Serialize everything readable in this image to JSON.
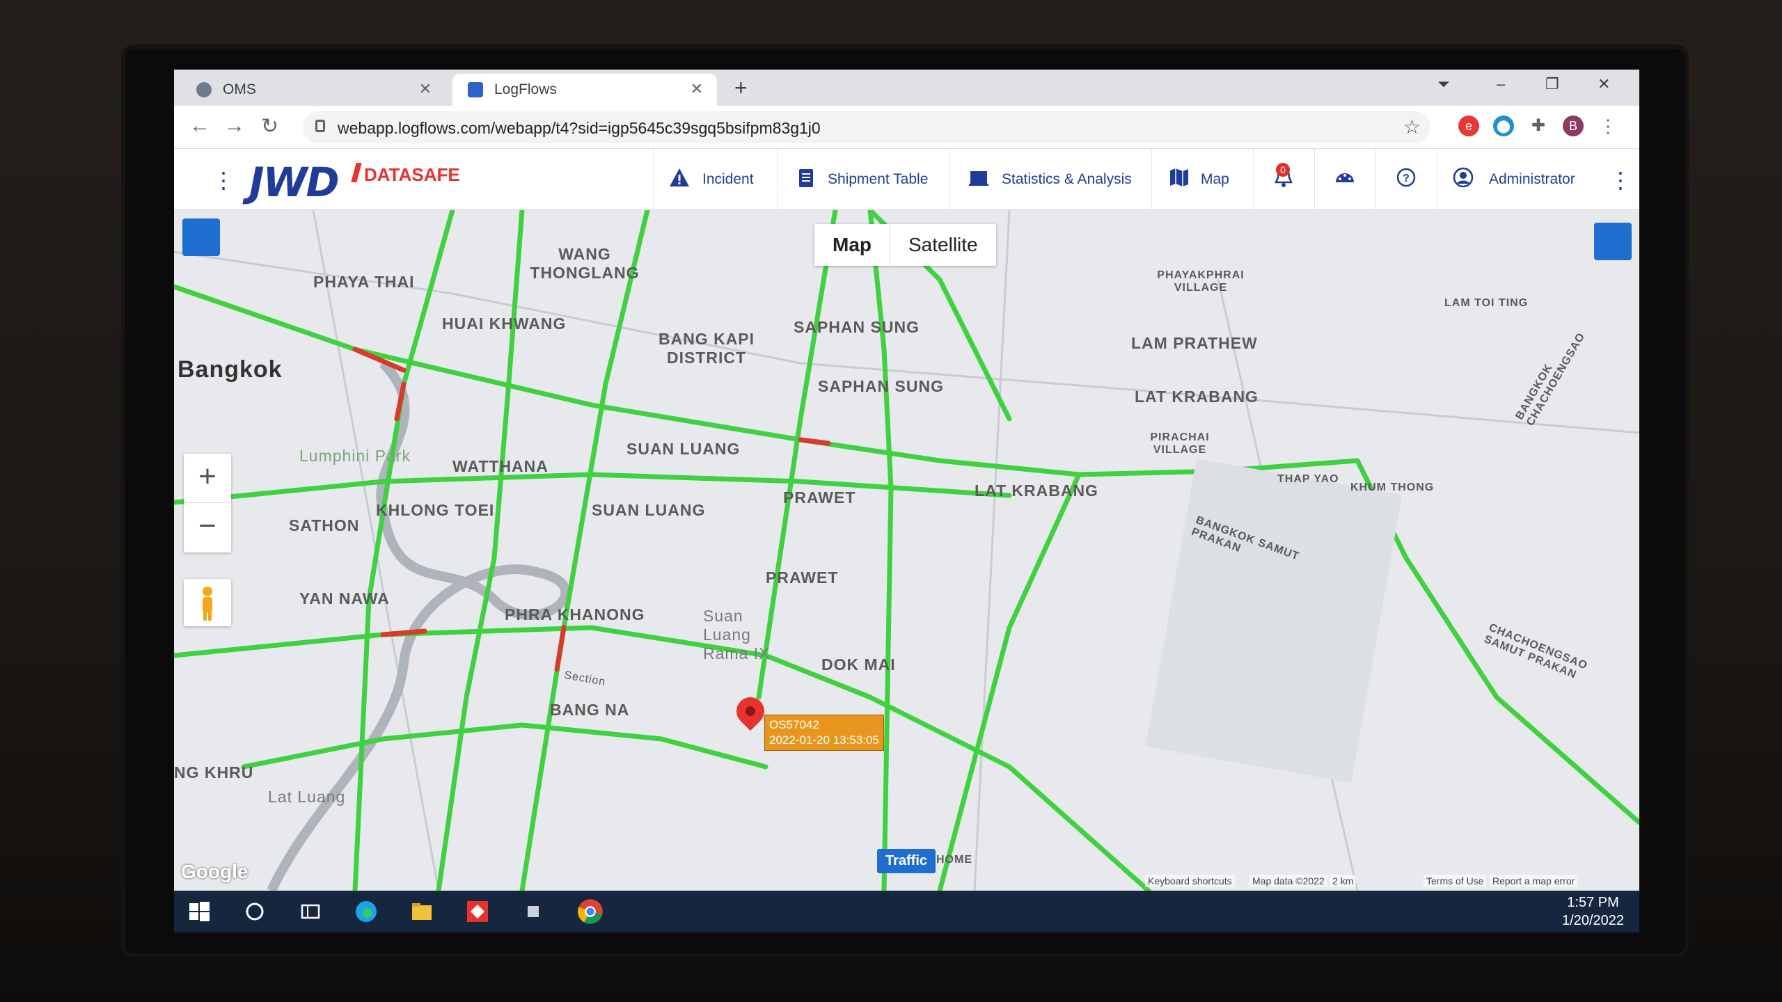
{
  "browser": {
    "tabs": [
      {
        "label": "OMS"
      },
      {
        "label": "LogFlows"
      }
    ],
    "url": "webapp.logflows.com/webapp/t4?sid=igp5645c39sgq5bsifpm83g1j0",
    "profile_initial": "B"
  },
  "app": {
    "logo_main": "JWD",
    "logo_sub": "DATASAFE",
    "nav": {
      "incident": "Incident",
      "shipment_table": "Shipment Table",
      "statistics": "Statistics & Analysis",
      "map": "Map",
      "notifications_count": "0",
      "user": "Administrator"
    }
  },
  "map": {
    "toggle": {
      "map": "Map",
      "satellite": "Satellite"
    },
    "zoom_in": "+",
    "zoom_out": "−",
    "marker": {
      "id": "OS57042",
      "timestamp": "2022-01-20 13:53:05"
    },
    "traffic_label": "Traffic",
    "google": "Google",
    "attribution": {
      "shortcuts": "Keyboard shortcuts",
      "data": "Map data ©2022",
      "scale": "2 km",
      "terms": "Terms of Use",
      "report": "Report a map error"
    },
    "places": {
      "bangkok": "Bangkok",
      "phaya_thai": "PHAYA THAI",
      "wang_thonglang": "WANG THONGLANG",
      "huai_khwang": "HUAI KHWANG",
      "bang_kapi": "BANG KAPI DISTRICT",
      "saphan_sung1": "SAPHAN SUNG",
      "saphan_sung2": "SAPHAN SUNG",
      "lam_prathew": "LAM PRATHEW",
      "lat_krabang1": "LAT KRABANG",
      "lat_krabang2": "LAT KRABANG",
      "watthana": "WATTHANA",
      "suan_luang1": "SUAN LUANG",
      "suan_luang2": "SUAN LUANG",
      "khlong_toei": "KHLONG TOEI",
      "prawet1": "PRAWET",
      "prawet2": "PRAWET",
      "sathon": "SATHON",
      "yan_nawa": "YAN NAWA",
      "phra_khanong": "PHRA KHANONG",
      "dok_mai": "DOK MAI",
      "bang_na": "BANG NA",
      "lumphini": "Lumphini Park",
      "suan_luang_rama": "Suan Luang Rama IX",
      "phayakphrai": "PHAYAKPHRAI VILLAGE",
      "pirachai": "PIRACHAI VILLAGE",
      "thap_yao": "THAP YAO",
      "khum_thong": "KHUM THONG",
      "lam_toi_ting": "LAM TOI TING",
      "bangkok_samut": "BANGKOK SAMUT PRAKAN",
      "chachoengsao": "CHACHOENGSAO SAMUT PRAKAN",
      "bangkok_chachoengsao": "BANGKOK CHACHOENGSAO",
      "khru": "NG KHRU",
      "lat_luang": "Lat Luang",
      "home": "HOME",
      "section": "Section"
    }
  },
  "taskbar": {
    "time": "1:57 PM",
    "date": "1/20/2022"
  },
  "colors": {
    "brand_blue": "#1f3c99",
    "brand_red": "#e8322d",
    "traffic_green": "#3fd13f",
    "traffic_red": "#d93a2b",
    "marker_orange": "#e8961e"
  }
}
